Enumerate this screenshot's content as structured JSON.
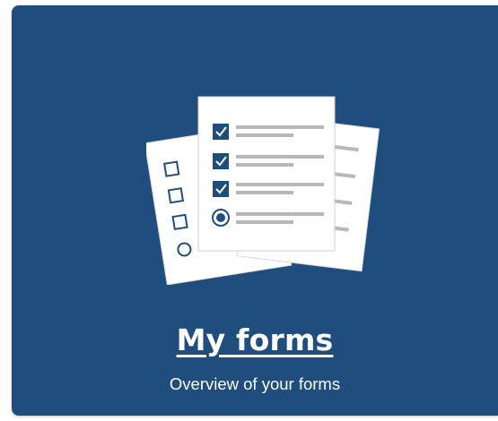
{
  "card": {
    "title": "My forms",
    "subtitle": "Overview of your forms",
    "illustration_icon": "forms-stack-icon"
  },
  "colors": {
    "card_background": "#1f4e7e",
    "text": "#ffffff",
    "paper": "#ffffff",
    "line": "#b8b8b8",
    "check": "#1f4e7e"
  }
}
